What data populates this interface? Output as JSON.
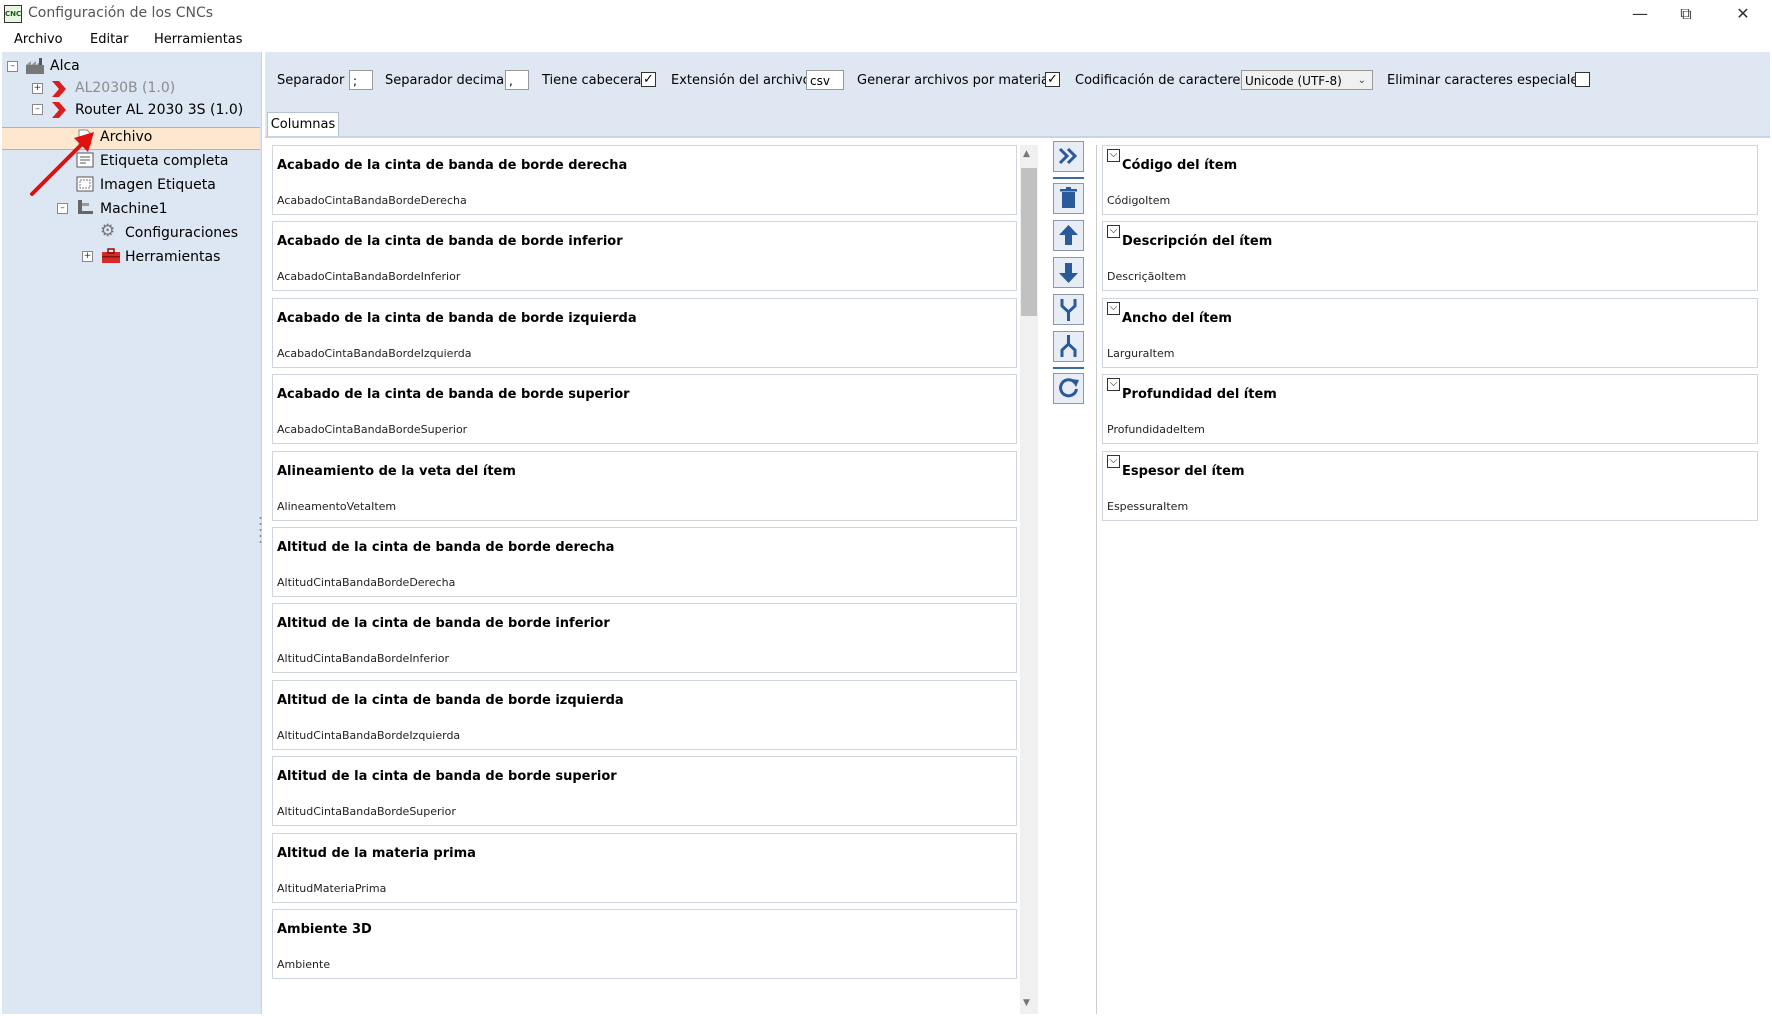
{
  "window": {
    "title": "Configuración de los CNCs",
    "app_icon_text": "CNC"
  },
  "menu": [
    "Archivo",
    "Editar",
    "Herramientas"
  ],
  "tree": [
    {
      "label": "Alca",
      "level": 0,
      "expander": "minus",
      "icon": "factory-icon"
    },
    {
      "label": "AL2030B (1.0)",
      "level": 1,
      "expander": "plus",
      "icon": "red-chevron-icon",
      "muted": true
    },
    {
      "label": "Router AL 2030 3S (1.0)",
      "level": 1,
      "expander": "minus",
      "icon": "red-chevron-icon"
    },
    {
      "label": "Archivo",
      "level": 2,
      "icon": "file-icon",
      "selected": true
    },
    {
      "label": "Etiqueta completa",
      "level": 2,
      "icon": "label-icon"
    },
    {
      "label": "Imagen Etiqueta",
      "level": 2,
      "icon": "label-image-icon"
    },
    {
      "label": "Machine1",
      "level": 2,
      "expander": "minus",
      "icon": "machine-icon"
    },
    {
      "label": "Configuraciones",
      "level": 3,
      "icon": "gear-icon"
    },
    {
      "label": "Herramientas",
      "level": 3,
      "expander": "plus",
      "icon": "toolbox-icon"
    }
  ],
  "toolbar": {
    "separator_label": "Separador",
    "separator_value": ";",
    "decimal_label": "Separador decimal",
    "decimal_value": ",",
    "header_label": "Tiene cabecera",
    "header_checked": true,
    "extension_label": "Extensión del archivo",
    "extension_value": "csv",
    "per_material_label": "Generar archivos por material",
    "per_material_checked": true,
    "encoding_label": "Codificación de caracteres",
    "encoding_value": "Unicode (UTF-8)",
    "special_chars_label": "Eliminar caracteres especiales",
    "special_chars_checked": false
  },
  "tabs": [
    "Columnas"
  ],
  "available_columns": [
    {
      "title": "Acabado de la cinta de banda de borde derecha",
      "key": "AcabadoCintaBandaBordeDerecha"
    },
    {
      "title": "Acabado de la cinta de banda de borde inferior",
      "key": "AcabadoCintaBandaBordeInferior"
    },
    {
      "title": "Acabado de la cinta de banda de borde izquierda",
      "key": "AcabadoCintaBandaBordeIzquierda"
    },
    {
      "title": "Acabado de la cinta de banda de borde superior",
      "key": "AcabadoCintaBandaBordeSuperior"
    },
    {
      "title": "Alineamiento de la veta del ítem",
      "key": "AlineamentoVetaItem"
    },
    {
      "title": "Altitud de la cinta de banda de borde derecha",
      "key": "AltitudCintaBandaBordeDerecha"
    },
    {
      "title": "Altitud de la cinta de banda de borde inferior",
      "key": "AltitudCintaBandaBordeInferior"
    },
    {
      "title": "Altitud de la cinta de banda de borde izquierda",
      "key": "AltitudCintaBandaBordeIzquierda"
    },
    {
      "title": "Altitud de la cinta de banda de borde superior",
      "key": "AltitudCintaBandaBordeSuperior"
    },
    {
      "title": "Altitud de la materia prima",
      "key": "AltitudMateriaPrima"
    },
    {
      "title": "Ambiente 3D",
      "key": "Ambiente"
    }
  ],
  "selected_columns": [
    {
      "title": "Código del ítem",
      "key": "CódigoItem"
    },
    {
      "title": "Descripción del ítem",
      "key": "DescriçãoItem"
    },
    {
      "title": "Ancho del ítem",
      "key": "LarguraItem"
    },
    {
      "title": "Profundidad del ítem",
      "key": "ProfundidadeItem"
    },
    {
      "title": "Espesor del ítem",
      "key": "EspessuraItem"
    }
  ],
  "action_buttons": [
    "add-all-icon",
    "delete-icon",
    "move-up-icon",
    "move-down-icon",
    "merge-icon",
    "split-icon",
    "refresh-icon"
  ],
  "colors": {
    "tree_bg": "#dde6f3",
    "selection_bg": "#fde8cf",
    "selection_border": "#f0a64a",
    "accent_blue": "#3a6aa8",
    "annotation_red": "#e01010"
  }
}
